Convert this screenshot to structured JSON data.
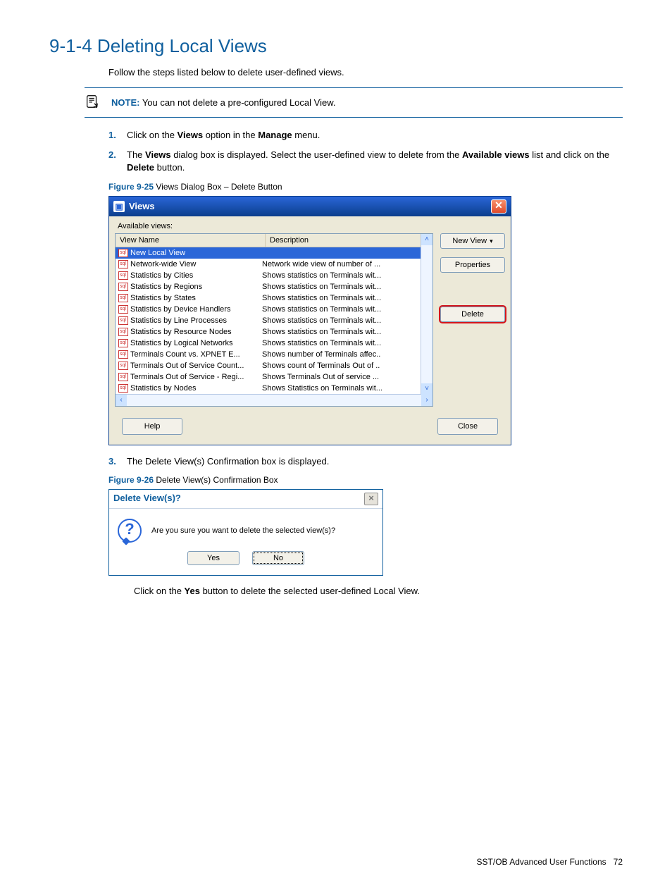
{
  "page": {
    "heading": "9-1-4 Deleting Local Views",
    "intro": "Follow the steps listed below to delete user-defined views.",
    "note_label": "NOTE:",
    "note_text": " You can not delete a pre-configured Local View.",
    "step1_pre": "Click on the ",
    "step1_b1": "Views",
    "step1_mid": " option in the ",
    "step1_b2": "Manage",
    "step1_post": " menu.",
    "step2_pre": "The ",
    "step2_b1": "Views",
    "step2_mid": " dialog box is displayed.  Select the user-defined view to delete from the ",
    "step2_b2": "Available views",
    "step2_mid2": " list and click on the ",
    "step2_b3": "Delete",
    "step2_post": " button.",
    "fig25_label": "Figure 9-25",
    "fig25_text": " Views Dialog Box – Delete Button",
    "step3": "The Delete View(s) Confirmation box is displayed.",
    "fig26_label": "Figure 9-26",
    "fig26_text": " Delete View(s) Confirmation Box",
    "after_confirm_pre": "Click on the ",
    "after_confirm_b": "Yes",
    "after_confirm_post": " button to delete the selected user-defined Local View.",
    "footer_section": "SST/OB Advanced User Functions",
    "footer_page": "72"
  },
  "views_dialog": {
    "title": "Views",
    "available_label": "Available views:",
    "col_name": "View Name",
    "col_desc": "Description",
    "rows": [
      {
        "name": "New Local View",
        "desc": "",
        "selected": true
      },
      {
        "name": "Network-wide View",
        "desc": "Network wide view of number of ..."
      },
      {
        "name": "Statistics by Cities",
        "desc": "Shows statistics on Terminals wit..."
      },
      {
        "name": "Statistics by Regions",
        "desc": "Shows statistics on Terminals wit..."
      },
      {
        "name": "Statistics by States",
        "desc": "Shows statistics on Terminals wit..."
      },
      {
        "name": "Statistics by Device Handlers",
        "desc": "Shows statistics on Terminals wit..."
      },
      {
        "name": "Statistics by Line Processes",
        "desc": "Shows statistics on Terminals wit..."
      },
      {
        "name": "Statistics by Resource Nodes",
        "desc": "Shows statistics on Terminals wit..."
      },
      {
        "name": "Statistics by Logical Networks",
        "desc": "Shows statistics on Terminals wit..."
      },
      {
        "name": "Terminals Count vs. XPNET E...",
        "desc": "Shows number of Terminals affec.."
      },
      {
        "name": "Terminals Out of Service Count...",
        "desc": "Shows count of Terminals Out of .."
      },
      {
        "name": "Terminals Out of Service - Regi...",
        "desc": "Shows Terminals Out of service ..."
      },
      {
        "name": "Statistics by Nodes",
        "desc": "Shows Statistics on Terminals wit..."
      }
    ],
    "btn_new": "New View",
    "btn_props": "Properties",
    "btn_delete": "Delete",
    "btn_help": "Help",
    "btn_close": "Close"
  },
  "confirm_dialog": {
    "title": "Delete View(s)?",
    "message": "Are you sure you want to delete the selected view(s)?",
    "btn_yes": "Yes",
    "btn_no": "No"
  }
}
